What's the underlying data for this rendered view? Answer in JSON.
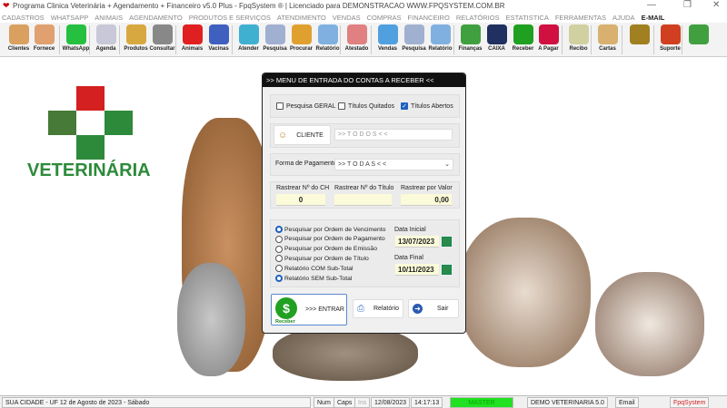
{
  "window": {
    "title": "Programa Clinica Veterinária + Agendamento + Financeiro v5.0 Plus - FpqSystem ® | Licenciado para  DEMONSTRACAO WWW.FPQSYSTEM.COM.BR",
    "minimize": "—",
    "maximize": "❐",
    "close": "✕"
  },
  "menu": [
    "CADASTROS",
    "WHATSAPP",
    "ANIMAIS",
    "AGENDAMENTO",
    "PRODUTOS E SERVIÇOS",
    "ATENDIMENTO",
    "VENDAS",
    "COMPRAS",
    "FINANCEIRO",
    "RELATÓRIOS",
    "ESTATISTICA",
    "FERRAMENTAS",
    "AJUDA"
  ],
  "menu_email": "E-MAIL",
  "toolbar": [
    {
      "label": "Clientes",
      "color": "#d9a060"
    },
    {
      "label": "Fornece",
      "color": "#e0a070"
    },
    {
      "label": "WhatsApp",
      "color": "#25c040"
    },
    {
      "label": "Agenda",
      "color": "#c8c8d8"
    },
    {
      "label": "Produtos",
      "color": "#d8a840"
    },
    {
      "label": "Consultar",
      "color": "#888888"
    },
    {
      "label": "Animais",
      "color": "#e02020"
    },
    {
      "label": "Vacinas",
      "color": "#4060c0"
    },
    {
      "label": "Atender",
      "color": "#40b0d0"
    },
    {
      "label": "Pesquisa",
      "color": "#a0b0d0"
    },
    {
      "label": "Procurar",
      "color": "#e0a030"
    },
    {
      "label": "Relatório",
      "color": "#80b0e0"
    },
    {
      "label": "Atestado",
      "color": "#e08080"
    },
    {
      "label": "Vendas",
      "color": "#50a0e0"
    },
    {
      "label": "Pesquisa",
      "color": "#a0b0d0"
    },
    {
      "label": "Relatório",
      "color": "#80b0e0"
    },
    {
      "label": "Finanças",
      "color": "#40a040"
    },
    {
      "label": "CAIXA",
      "color": "#203060"
    },
    {
      "label": "Receber",
      "color": "#20a020"
    },
    {
      "label": "A Pagar",
      "color": "#d01040"
    },
    {
      "label": "Recibo",
      "color": "#d0d0a0"
    },
    {
      "label": "Cartas",
      "color": "#d8b070"
    },
    {
      "label": "",
      "color": "#a08020"
    },
    {
      "label": "Suporte",
      "color": "#d04020"
    },
    {
      "label": "",
      "color": "#40a040"
    }
  ],
  "logo": {
    "text": "VETERINÁRIA",
    "red": "#d42020",
    "green": "#2d8a3a"
  },
  "dialog": {
    "title": ">>  MENU DE ENTRADA DO CONTAS A RECEBER  <<",
    "checks": [
      {
        "label": "Pesquisa GERAL",
        "checked": false
      },
      {
        "label": "Títulos Quitados",
        "checked": false
      },
      {
        "label": "Títulos Abertos",
        "checked": true
      }
    ],
    "cliente_button": "CLIENTE",
    "cliente_value": ">> T O D O S < <",
    "pagamento_label": "Forma de Pagamento",
    "pagamento_value": ">> T O D A S < <",
    "rastrear": [
      {
        "label": "Rastrear Nº do CH",
        "value": "0"
      },
      {
        "label": "Rastrear Nº do Título",
        "value": ""
      },
      {
        "label": "Rastrear por Valor",
        "value": "0,00"
      }
    ],
    "radios": [
      {
        "label": "Pesquisar por Ordem de Vencimento",
        "checked": true
      },
      {
        "label": "Pesquisar por Ordem de Pagamento",
        "checked": false
      },
      {
        "label": "Pesquisar por Ordem de Emissão",
        "checked": false
      },
      {
        "label": "Pesquisar por Ordem de Título",
        "checked": false
      },
      {
        "label": "Relatório COM Sub-Total",
        "checked": false
      },
      {
        "label": "Relatório SEM Sub-Total",
        "checked": true
      }
    ],
    "data_inicial_label": "Data Inicial",
    "data_inicial": "13/07/2023",
    "data_final_label": "Data Final",
    "data_final": "10/11/2023",
    "entrar_icon_label": "Receber",
    "entrar_label": ">>> ENTRAR",
    "relatorio_label": "Relatório",
    "sair_label": "Sair"
  },
  "status": {
    "city": "SUA CIDADE - UF 12 de Agosto de 2023 - Sábado",
    "num": "Num",
    "caps": "Caps",
    "ins": "Ins",
    "date": "12/08/2023",
    "time": "14:17:13",
    "user": "MASTER",
    "company": "DEMO VETERINARIA 5.0",
    "email": "Email",
    "brand": "FpqSystem"
  }
}
